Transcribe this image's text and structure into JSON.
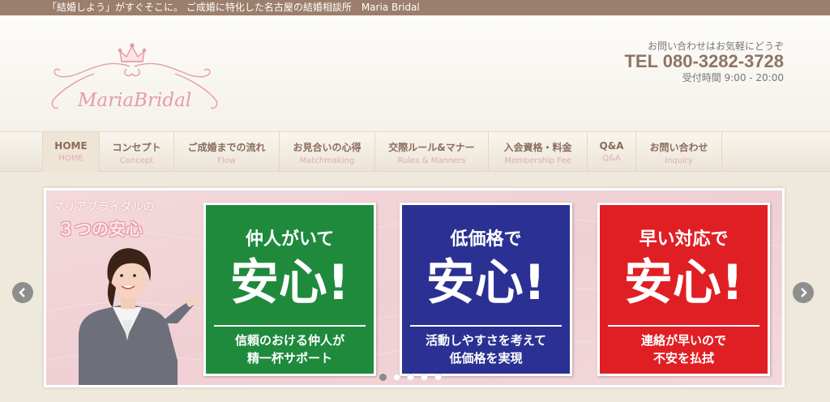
{
  "top_bar": {
    "tagline": "「結婚しよう」がすぐそこに。 ご成婚に特化した名古屋の結婚相談所　Maria Bridal"
  },
  "logo": {
    "text": "MariaBridal"
  },
  "contact": {
    "note": "お問い合わせはお気軽にどうぞ",
    "tel": "TEL 080-3282-3728",
    "hours": "受付時間 9:00 - 20:00"
  },
  "nav": {
    "items": [
      {
        "jp": "HOME",
        "en": "HOME",
        "active": true
      },
      {
        "jp": "コンセプト",
        "en": "Concept"
      },
      {
        "jp": "ご成婚までの流れ",
        "en": "Flow"
      },
      {
        "jp": "お見合いの心得",
        "en": "Matchmaking"
      },
      {
        "jp": "交際ルール&マナー",
        "en": "Rules & Manners"
      },
      {
        "jp": "入会資格・料金",
        "en": "Membership Fee"
      },
      {
        "jp": "Q&A",
        "en": "Q&A"
      },
      {
        "jp": "お問い合わせ",
        "en": "Inquiry"
      }
    ]
  },
  "slide": {
    "heading_line1": "マリアブライダルの",
    "heading_line2": "３つの安心",
    "panels": [
      {
        "title": "仲人がいて",
        "main": "安心!",
        "sub_line1": "信頼のおける仲人が",
        "sub_line2": "精一杯サポート",
        "color": "#1f8a3c"
      },
      {
        "title": "低価格で",
        "main": "安心!",
        "sub_line1": "活動しやすさを考えて",
        "sub_line2": "低価格を実現",
        "color": "#2b3192"
      },
      {
        "title": "早い対応で",
        "main": "安心!",
        "sub_line1": "連絡が早いので",
        "sub_line2": "不安を払拭",
        "color": "#e01f24"
      }
    ]
  },
  "slider": {
    "prev_icon": "chevron-left-icon",
    "next_icon": "chevron-right-icon",
    "dot_count": 5,
    "active_dot": 1
  },
  "colors": {
    "top_bar": "#9b7e6b",
    "nav_text": "#8a6c5c",
    "nav_sub": "#e3a9b3",
    "tel": "#8d7466"
  }
}
